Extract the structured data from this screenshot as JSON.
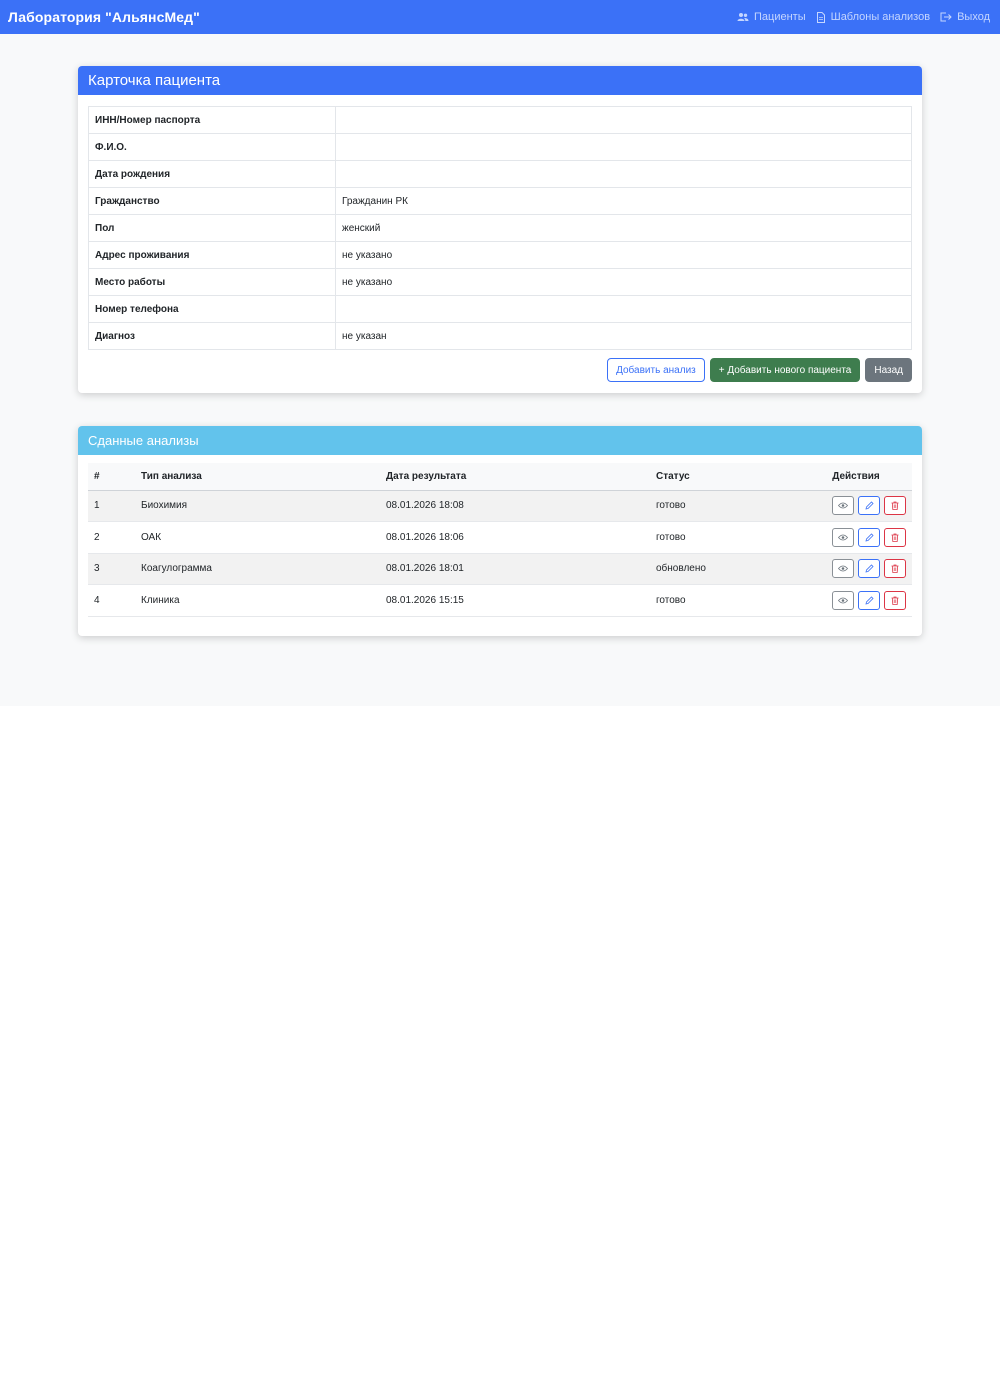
{
  "navbar": {
    "brand": "Лаборатория \"АльянсМед\"",
    "links": [
      {
        "label": "Пациенты",
        "icon": "users-icon"
      },
      {
        "label": "Шаблоны анализов",
        "icon": "document-icon"
      },
      {
        "label": "Выход",
        "icon": "logout-icon"
      }
    ]
  },
  "patient_card": {
    "title": "Карточка пациента",
    "rows": [
      {
        "label": "ИНН/Номер паспорта",
        "value": ""
      },
      {
        "label": "Ф.И.О.",
        "value": ""
      },
      {
        "label": "Дата рождения",
        "value": ""
      },
      {
        "label": "Гражданство",
        "value": "Гражданин РК"
      },
      {
        "label": "Пол",
        "value": "женский"
      },
      {
        "label": "Адрес проживания",
        "value": "не указано"
      },
      {
        "label": "Место работы",
        "value": "не указано"
      },
      {
        "label": "Номер телефона",
        "value": ""
      },
      {
        "label": "Диагноз",
        "value": "не указан"
      }
    ],
    "buttons": {
      "add_test": "Добавить анализ",
      "add_patient": "+ Добавить нового пациента",
      "back": "Назад"
    }
  },
  "tests_card": {
    "title": "Сданные анализы",
    "columns": [
      "#",
      "Тип анализа",
      "Дата результата",
      "Статус",
      "Действия"
    ],
    "rows": [
      {
        "num": "1",
        "type": "Биохимия",
        "date": "08.01.2026 18:08",
        "status": "готово"
      },
      {
        "num": "2",
        "type": "ОАК",
        "date": "08.01.2026 18:06",
        "status": "готово"
      },
      {
        "num": "3",
        "type": "Коагулограмма",
        "date": "08.01.2026 18:01",
        "status": "обновлено"
      },
      {
        "num": "4",
        "type": "Клиника",
        "date": "08.01.2026 15:15",
        "status": "готово"
      }
    ]
  },
  "colors": {
    "primary": "#3b71f7",
    "info": "#62c3ec",
    "success": "#3e7d4e",
    "secondary": "#6c757d",
    "danger": "#dc3545"
  }
}
